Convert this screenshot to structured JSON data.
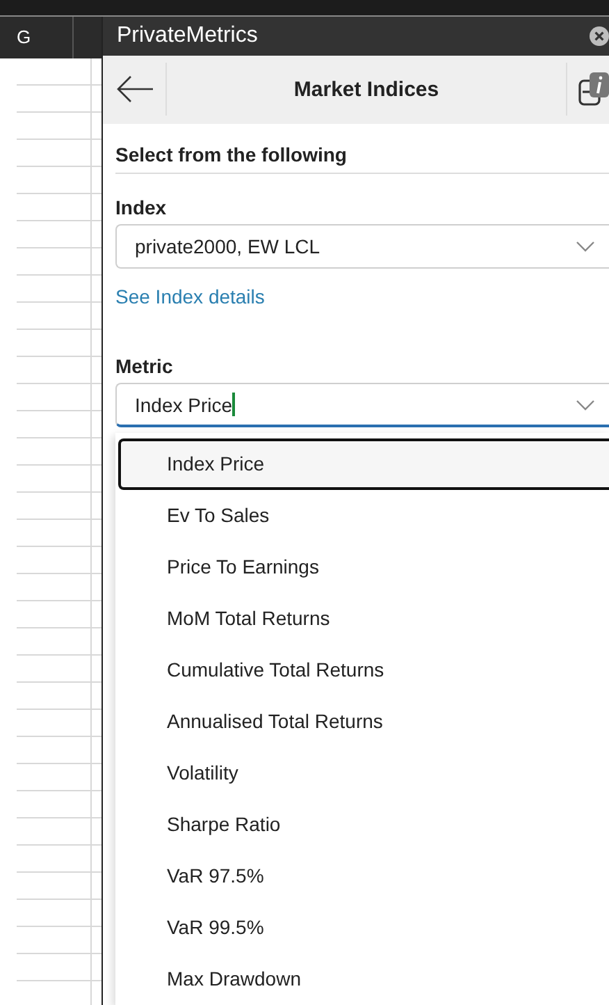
{
  "spreadsheet": {
    "column_header": "G"
  },
  "panel": {
    "title": "PrivateMetrics"
  },
  "nav": {
    "title": "Market Indices"
  },
  "form": {
    "heading": "Select from the following",
    "index": {
      "label": "Index",
      "value": "private2000, EW LCL"
    },
    "link": "See Index details",
    "metric": {
      "label": "Metric",
      "value": "Index Price",
      "focused": true
    }
  },
  "metric_options": [
    {
      "label": "Index Price",
      "selected": true
    },
    {
      "label": "Ev To Sales",
      "selected": false
    },
    {
      "label": "Price To Earnings",
      "selected": false
    },
    {
      "label": "MoM Total Returns",
      "selected": false
    },
    {
      "label": "Cumulative Total Returns",
      "selected": false
    },
    {
      "label": "Annualised Total Returns",
      "selected": false
    },
    {
      "label": "Volatility",
      "selected": false
    },
    {
      "label": "Sharpe Ratio",
      "selected": false
    },
    {
      "label": "VaR 97.5%",
      "selected": false
    },
    {
      "label": "VaR 99.5%",
      "selected": false
    },
    {
      "label": "Max Drawdown",
      "selected": false
    }
  ]
}
